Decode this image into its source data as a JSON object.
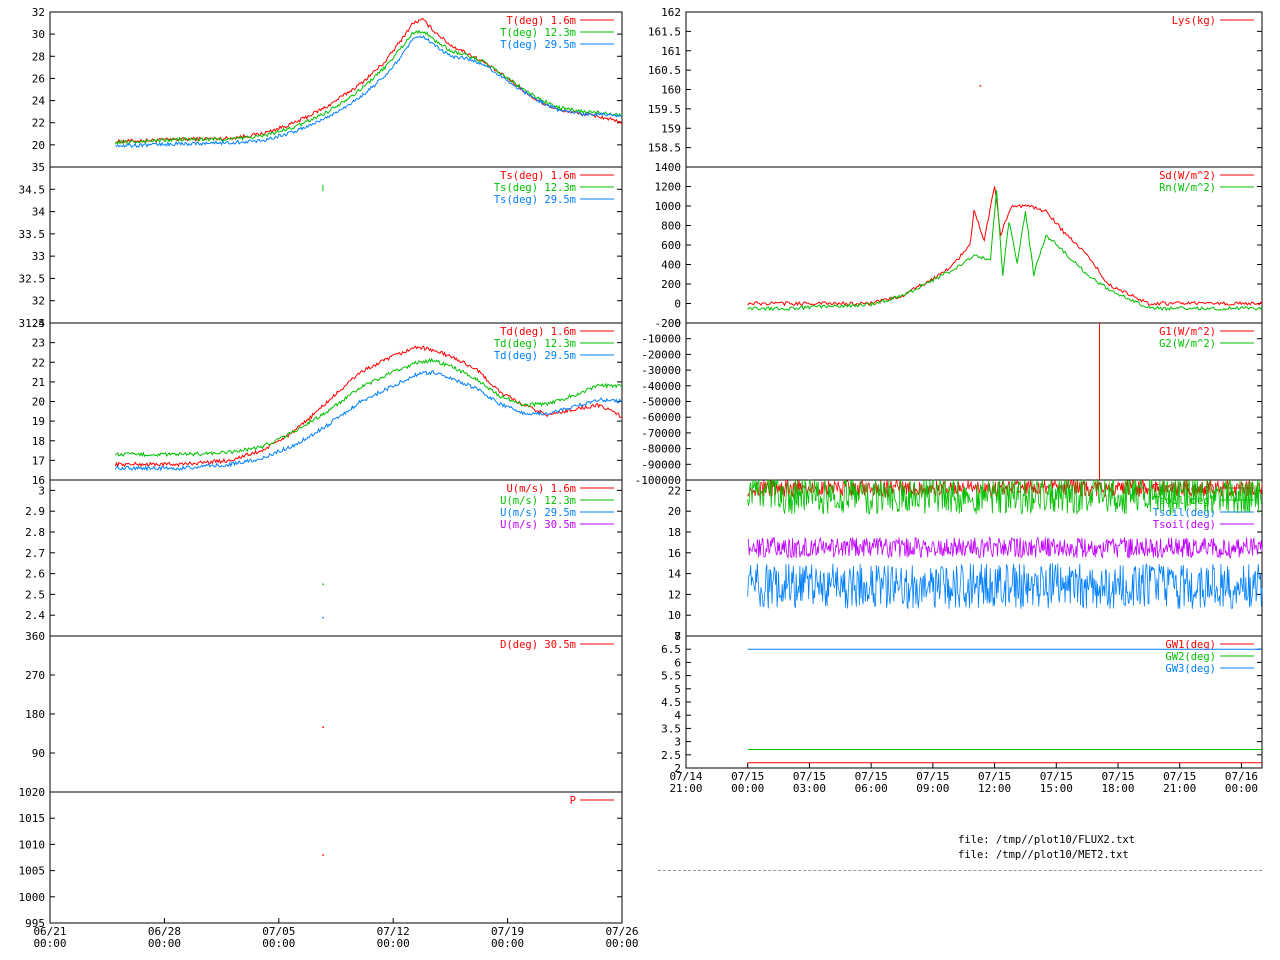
{
  "colors": {
    "red": "#ff0000",
    "green": "#00c000",
    "blue": "#0080ff",
    "magenta": "#c000ff",
    "dark_green": "#008000"
  },
  "files": [
    "file: /tmp//plot10/FLUX2.txt",
    "file: /tmp//plot10/MET2.txt"
  ],
  "chart_data": [
    {
      "id": "temp",
      "type": "line",
      "ylim": [
        18,
        32
      ],
      "yticks": [
        "20",
        "22",
        "24",
        "26",
        "28",
        "30",
        "32"
      ],
      "xlim": [
        0,
        35
      ],
      "series": [
        {
          "name": "T(deg)  1.6m",
          "color": "#ff0000",
          "points": [
            [
              4,
              20.3
            ],
            [
              8,
              20.5
            ],
            [
              11,
              20.6
            ],
            [
              13,
              21.0
            ],
            [
              15,
              22.0
            ],
            [
              17,
              23.5
            ],
            [
              19,
              25.5
            ],
            [
              20.5,
              27.5
            ],
            [
              21.5,
              29.5
            ],
            [
              22.2,
              31.0
            ],
            [
              22.8,
              31.3
            ],
            [
              23.5,
              30.3
            ],
            [
              24.5,
              29.0
            ],
            [
              25.5,
              28.3
            ],
            [
              26.5,
              27.5
            ],
            [
              28,
              26.0
            ],
            [
              29.5,
              24.3
            ],
            [
              31,
              23.2
            ],
            [
              32.5,
              22.8
            ],
            [
              33.5,
              22.6
            ],
            [
              34.3,
              22.3
            ],
            [
              35,
              21.9
            ]
          ]
        },
        {
          "name": "T(deg) 12.3m",
          "color": "#00c000",
          "points": [
            [
              4,
              20.2
            ],
            [
              8,
              20.5
            ],
            [
              11,
              20.5
            ],
            [
              13,
              20.8
            ],
            [
              15,
              21.6
            ],
            [
              17,
              23.0
            ],
            [
              19,
              25.0
            ],
            [
              20.5,
              27.0
            ],
            [
              21.5,
              28.8
            ],
            [
              22.2,
              30.1
            ],
            [
              22.8,
              30.3
            ],
            [
              23.5,
              29.5
            ],
            [
              24.5,
              28.5
            ],
            [
              25.5,
              28.1
            ],
            [
              26.5,
              27.5
            ],
            [
              28,
              26.0
            ],
            [
              29.5,
              24.5
            ],
            [
              31,
              23.4
            ],
            [
              32.5,
              23.0
            ],
            [
              34,
              22.9
            ],
            [
              35,
              22.7
            ]
          ]
        },
        {
          "name": "T(deg) 29.5m",
          "color": "#0080ff",
          "points": [
            [
              4,
              19.9
            ],
            [
              8,
              20.1
            ],
            [
              11,
              20.2
            ],
            [
              13,
              20.4
            ],
            [
              15,
              21.2
            ],
            [
              17,
              22.5
            ],
            [
              19,
              24.3
            ],
            [
              20.5,
              26.2
            ],
            [
              21.5,
              28.0
            ],
            [
              22.2,
              29.5
            ],
            [
              22.8,
              29.8
            ],
            [
              23.5,
              29.0
            ],
            [
              24.5,
              28.0
            ],
            [
              25.5,
              27.8
            ],
            [
              26.5,
              27.3
            ],
            [
              28,
              25.8
            ],
            [
              29.5,
              24.3
            ],
            [
              31,
              23.2
            ],
            [
              32.5,
              22.8
            ],
            [
              34,
              22.8
            ],
            [
              35,
              22.6
            ]
          ]
        }
      ]
    },
    {
      "id": "ts",
      "type": "line",
      "ylim": [
        31.5,
        35
      ],
      "yticks": [
        "31.5",
        "32",
        "32.5",
        "33",
        "33.5",
        "34",
        "34.5",
        "35"
      ],
      "xlim": [
        0,
        35
      ],
      "series": [
        {
          "name": "Ts(deg)  1.6m",
          "color": "#ff0000",
          "points": []
        },
        {
          "name": "Ts(deg) 12.3m",
          "color": "#00c000",
          "points": [
            [
              16.7,
              34.45
            ],
            [
              16.7,
              34.6
            ]
          ]
        },
        {
          "name": "Ts(deg) 29.5m",
          "color": "#0080ff",
          "points": []
        }
      ]
    },
    {
      "id": "td",
      "type": "line",
      "ylim": [
        16,
        24
      ],
      "yticks": [
        "16",
        "17",
        "18",
        "19",
        "20",
        "21",
        "22",
        "23",
        "24"
      ],
      "xlim": [
        0,
        35
      ],
      "series": [
        {
          "name": "Td(deg)  1.6m",
          "color": "#ff0000",
          "points": [
            [
              4,
              16.8
            ],
            [
              8,
              16.8
            ],
            [
              11,
              17.0
            ],
            [
              13,
              17.5
            ],
            [
              15,
              18.5
            ],
            [
              17,
              20.0
            ],
            [
              19,
              21.5
            ],
            [
              21,
              22.3
            ],
            [
              22.5,
              22.8
            ],
            [
              23.5,
              22.6
            ],
            [
              24.5,
              22.3
            ],
            [
              26,
              21.7
            ],
            [
              27.5,
              20.5
            ],
            [
              29,
              19.8
            ],
            [
              30.5,
              19.3
            ],
            [
              32,
              19.6
            ],
            [
              33.5,
              19.8
            ],
            [
              34.5,
              19.5
            ],
            [
              35,
              19.2
            ]
          ]
        },
        {
          "name": "Td(deg) 12.3m",
          "color": "#00c000",
          "points": [
            [
              4,
              17.3
            ],
            [
              8,
              17.3
            ],
            [
              11,
              17.4
            ],
            [
              13,
              17.7
            ],
            [
              15,
              18.5
            ],
            [
              17,
              19.5
            ],
            [
              19,
              20.7
            ],
            [
              21,
              21.5
            ],
            [
              22.5,
              22.0
            ],
            [
              23.5,
              22.1
            ],
            [
              24.5,
              21.8
            ],
            [
              26,
              21.2
            ],
            [
              27.5,
              20.3
            ],
            [
              29,
              19.8
            ],
            [
              30.5,
              19.9
            ],
            [
              32,
              20.3
            ],
            [
              33.5,
              20.8
            ],
            [
              35,
              20.8
            ]
          ]
        },
        {
          "name": "Td(deg) 29.5m",
          "color": "#0080ff",
          "points": [
            [
              4,
              16.6
            ],
            [
              8,
              16.6
            ],
            [
              11,
              16.8
            ],
            [
              13,
              17.1
            ],
            [
              15,
              17.8
            ],
            [
              17,
              18.8
            ],
            [
              19,
              20.0
            ],
            [
              21,
              20.8
            ],
            [
              22.5,
              21.4
            ],
            [
              23.5,
              21.5
            ],
            [
              24.5,
              21.2
            ],
            [
              26,
              20.7
            ],
            [
              27.5,
              19.9
            ],
            [
              29,
              19.4
            ],
            [
              30.5,
              19.4
            ],
            [
              32,
              19.7
            ],
            [
              33.5,
              20.1
            ],
            [
              35,
              20.0
            ]
          ]
        }
      ]
    },
    {
      "id": "u",
      "type": "scatter",
      "ylim": [
        2.3,
        3.05
      ],
      "yticks": [
        "2.4",
        "2.5",
        "2.6",
        "2.7",
        "2.8",
        "2.9",
        "3"
      ],
      "xlim": [
        0,
        35
      ],
      "series": [
        {
          "name": "U(m/s)  1.6m",
          "color": "#ff0000",
          "points": []
        },
        {
          "name": "U(m/s) 12.3m",
          "color": "#00c000",
          "points": [
            [
              16.7,
              2.55
            ]
          ]
        },
        {
          "name": "U(m/s) 29.5m",
          "color": "#0080ff",
          "points": [
            [
              16.7,
              2.39
            ]
          ]
        },
        {
          "name": "U(m/s) 30.5m",
          "color": "#c000ff",
          "points": []
        }
      ]
    },
    {
      "id": "dir",
      "type": "scatter",
      "ylim": [
        0,
        360
      ],
      "yticks": [
        "90",
        "180",
        "270",
        "360"
      ],
      "xlim": [
        0,
        35
      ],
      "series": [
        {
          "name": "D(deg)  30.5m",
          "color": "#ff0000",
          "points": [
            [
              16.7,
              150
            ]
          ]
        }
      ]
    },
    {
      "id": "p",
      "type": "scatter",
      "ylim": [
        995,
        1020
      ],
      "yticks": [
        "995",
        "1000",
        "1005",
        "1010",
        "1015",
        "1020"
      ],
      "xlim": [
        0,
        35
      ],
      "series": [
        {
          "name": "P",
          "color": "#ff0000",
          "points": [
            [
              16.7,
              1008
            ]
          ]
        }
      ]
    },
    {
      "id": "lys",
      "type": "scatter",
      "ylim": [
        158,
        162
      ],
      "yticks": [
        "158.5",
        "159",
        "159.5",
        "160",
        "160.5",
        "161",
        "161.5",
        "162"
      ],
      "xlim": [
        -3,
        25
      ],
      "series": [
        {
          "name": "Lys(kg)",
          "color": "#ff0000",
          "points": [
            [
              11.3,
              160.1
            ]
          ]
        }
      ]
    },
    {
      "id": "rad",
      "type": "line",
      "ylim": [
        -200,
        1400
      ],
      "yticks": [
        "-200",
        "0",
        "200",
        "400",
        "600",
        "800",
        "1000",
        "1200",
        "1400"
      ],
      "xlim": [
        -3,
        25
      ],
      "series": [
        {
          "name": "Sd(W/m^2)",
          "color": "#ff0000",
          "points": [
            [
              0,
              0
            ],
            [
              6,
              0
            ],
            [
              7.5,
              80
            ],
            [
              9,
              250
            ],
            [
              10,
              400
            ],
            [
              10.8,
              600
            ],
            [
              11,
              950
            ],
            [
              11.5,
              650
            ],
            [
              12,
              1200
            ],
            [
              12.3,
              700
            ],
            [
              12.8,
              1000
            ],
            [
              13.5,
              1000
            ],
            [
              14.5,
              950
            ],
            [
              15.5,
              700
            ],
            [
              16.5,
              500
            ],
            [
              17.5,
              200
            ],
            [
              18.5,
              100
            ],
            [
              19.5,
              0
            ],
            [
              25,
              0
            ]
          ]
        },
        {
          "name": "Rn(W/m^2)",
          "color": "#00c000",
          "points": [
            [
              0,
              -50
            ],
            [
              2,
              -50
            ],
            [
              4,
              -30
            ],
            [
              6,
              -10
            ],
            [
              7.5,
              80
            ],
            [
              9,
              240
            ],
            [
              10,
              350
            ],
            [
              11,
              500
            ],
            [
              11.8,
              450
            ],
            [
              12.1,
              1150
            ],
            [
              12.4,
              300
            ],
            [
              12.7,
              850
            ],
            [
              13.1,
              400
            ],
            [
              13.5,
              950
            ],
            [
              13.9,
              300
            ],
            [
              14.5,
              700
            ],
            [
              15.5,
              500
            ],
            [
              16.5,
              300
            ],
            [
              17.5,
              150
            ],
            [
              18.5,
              50
            ],
            [
              19.5,
              -50
            ],
            [
              25,
              -50
            ]
          ]
        }
      ]
    },
    {
      "id": "g",
      "type": "line",
      "ylim": [
        -100000,
        0
      ],
      "yticks": [
        "-100000",
        "-90000",
        "-80000",
        "-70000",
        "-60000",
        "-50000",
        "-40000",
        "-30000",
        "-20000",
        "-10000",
        "0"
      ],
      "xlim": [
        -3,
        25
      ],
      "series": [
        {
          "name": "G1(W/m^2)",
          "color": "#ff0000",
          "points": [
            [
              17.1,
              -100000
            ],
            [
              17.1,
              0
            ]
          ]
        },
        {
          "name": "G2(W/m^2)",
          "color": "#00c000",
          "points": []
        }
      ]
    },
    {
      "id": "tsoil",
      "type": "band",
      "ylim": [
        8,
        23
      ],
      "yticks": [
        "8",
        "10",
        "12",
        "14",
        "16",
        "18",
        "20",
        "22"
      ],
      "xlim": [
        -3,
        25
      ],
      "series": [
        {
          "name": "Tsoil(deg)",
          "color": "#ff0000",
          "center": 22.2,
          "spread": 0.8
        },
        {
          "name": "Tsoil(deg)",
          "color": "#00c000",
          "center": 21.5,
          "spread": 1.8
        },
        {
          "name": "Tsoil(deg)",
          "color": "#0080ff",
          "center": 12.8,
          "spread": 2.2
        },
        {
          "name": "Tsoil(deg)",
          "color": "#c000ff",
          "center": 16.5,
          "spread": 1.0
        }
      ]
    },
    {
      "id": "gw",
      "type": "line",
      "ylim": [
        2,
        7
      ],
      "yticks": [
        "2",
        "2.5",
        "3",
        "3.5",
        "4",
        "4.5",
        "5",
        "5.5",
        "6",
        "6.5",
        "7"
      ],
      "xlim": [
        -3,
        25
      ],
      "series": [
        {
          "name": "GW1(deg)",
          "color": "#ff0000",
          "points": [
            [
              0,
              2.2
            ],
            [
              25,
              2.2
            ]
          ]
        },
        {
          "name": "GW2(deg)",
          "color": "#00c000",
          "points": [
            [
              0,
              2.7
            ],
            [
              25,
              2.7
            ]
          ]
        },
        {
          "name": "GW3(deg)",
          "color": "#0080ff",
          "points": [
            [
              0,
              6.5
            ],
            [
              25,
              6.5
            ]
          ]
        }
      ]
    }
  ],
  "x_left": {
    "ticks": [
      [
        "06/21",
        "00:00"
      ],
      [
        "06/28",
        "00:00"
      ],
      [
        "07/05",
        "00:00"
      ],
      [
        "07/12",
        "00:00"
      ],
      [
        "07/19",
        "00:00"
      ],
      [
        "07/26",
        "00:00"
      ]
    ]
  },
  "x_right": {
    "ticks": [
      [
        "07/14",
        "21:00"
      ],
      [
        "07/15",
        "00:00"
      ],
      [
        "07/15",
        "03:00"
      ],
      [
        "07/15",
        "06:00"
      ],
      [
        "07/15",
        "09:00"
      ],
      [
        "07/15",
        "12:00"
      ],
      [
        "07/15",
        "15:00"
      ],
      [
        "07/15",
        "18:00"
      ],
      [
        "07/15",
        "21:00"
      ],
      [
        "07/16",
        "00:00"
      ]
    ]
  }
}
